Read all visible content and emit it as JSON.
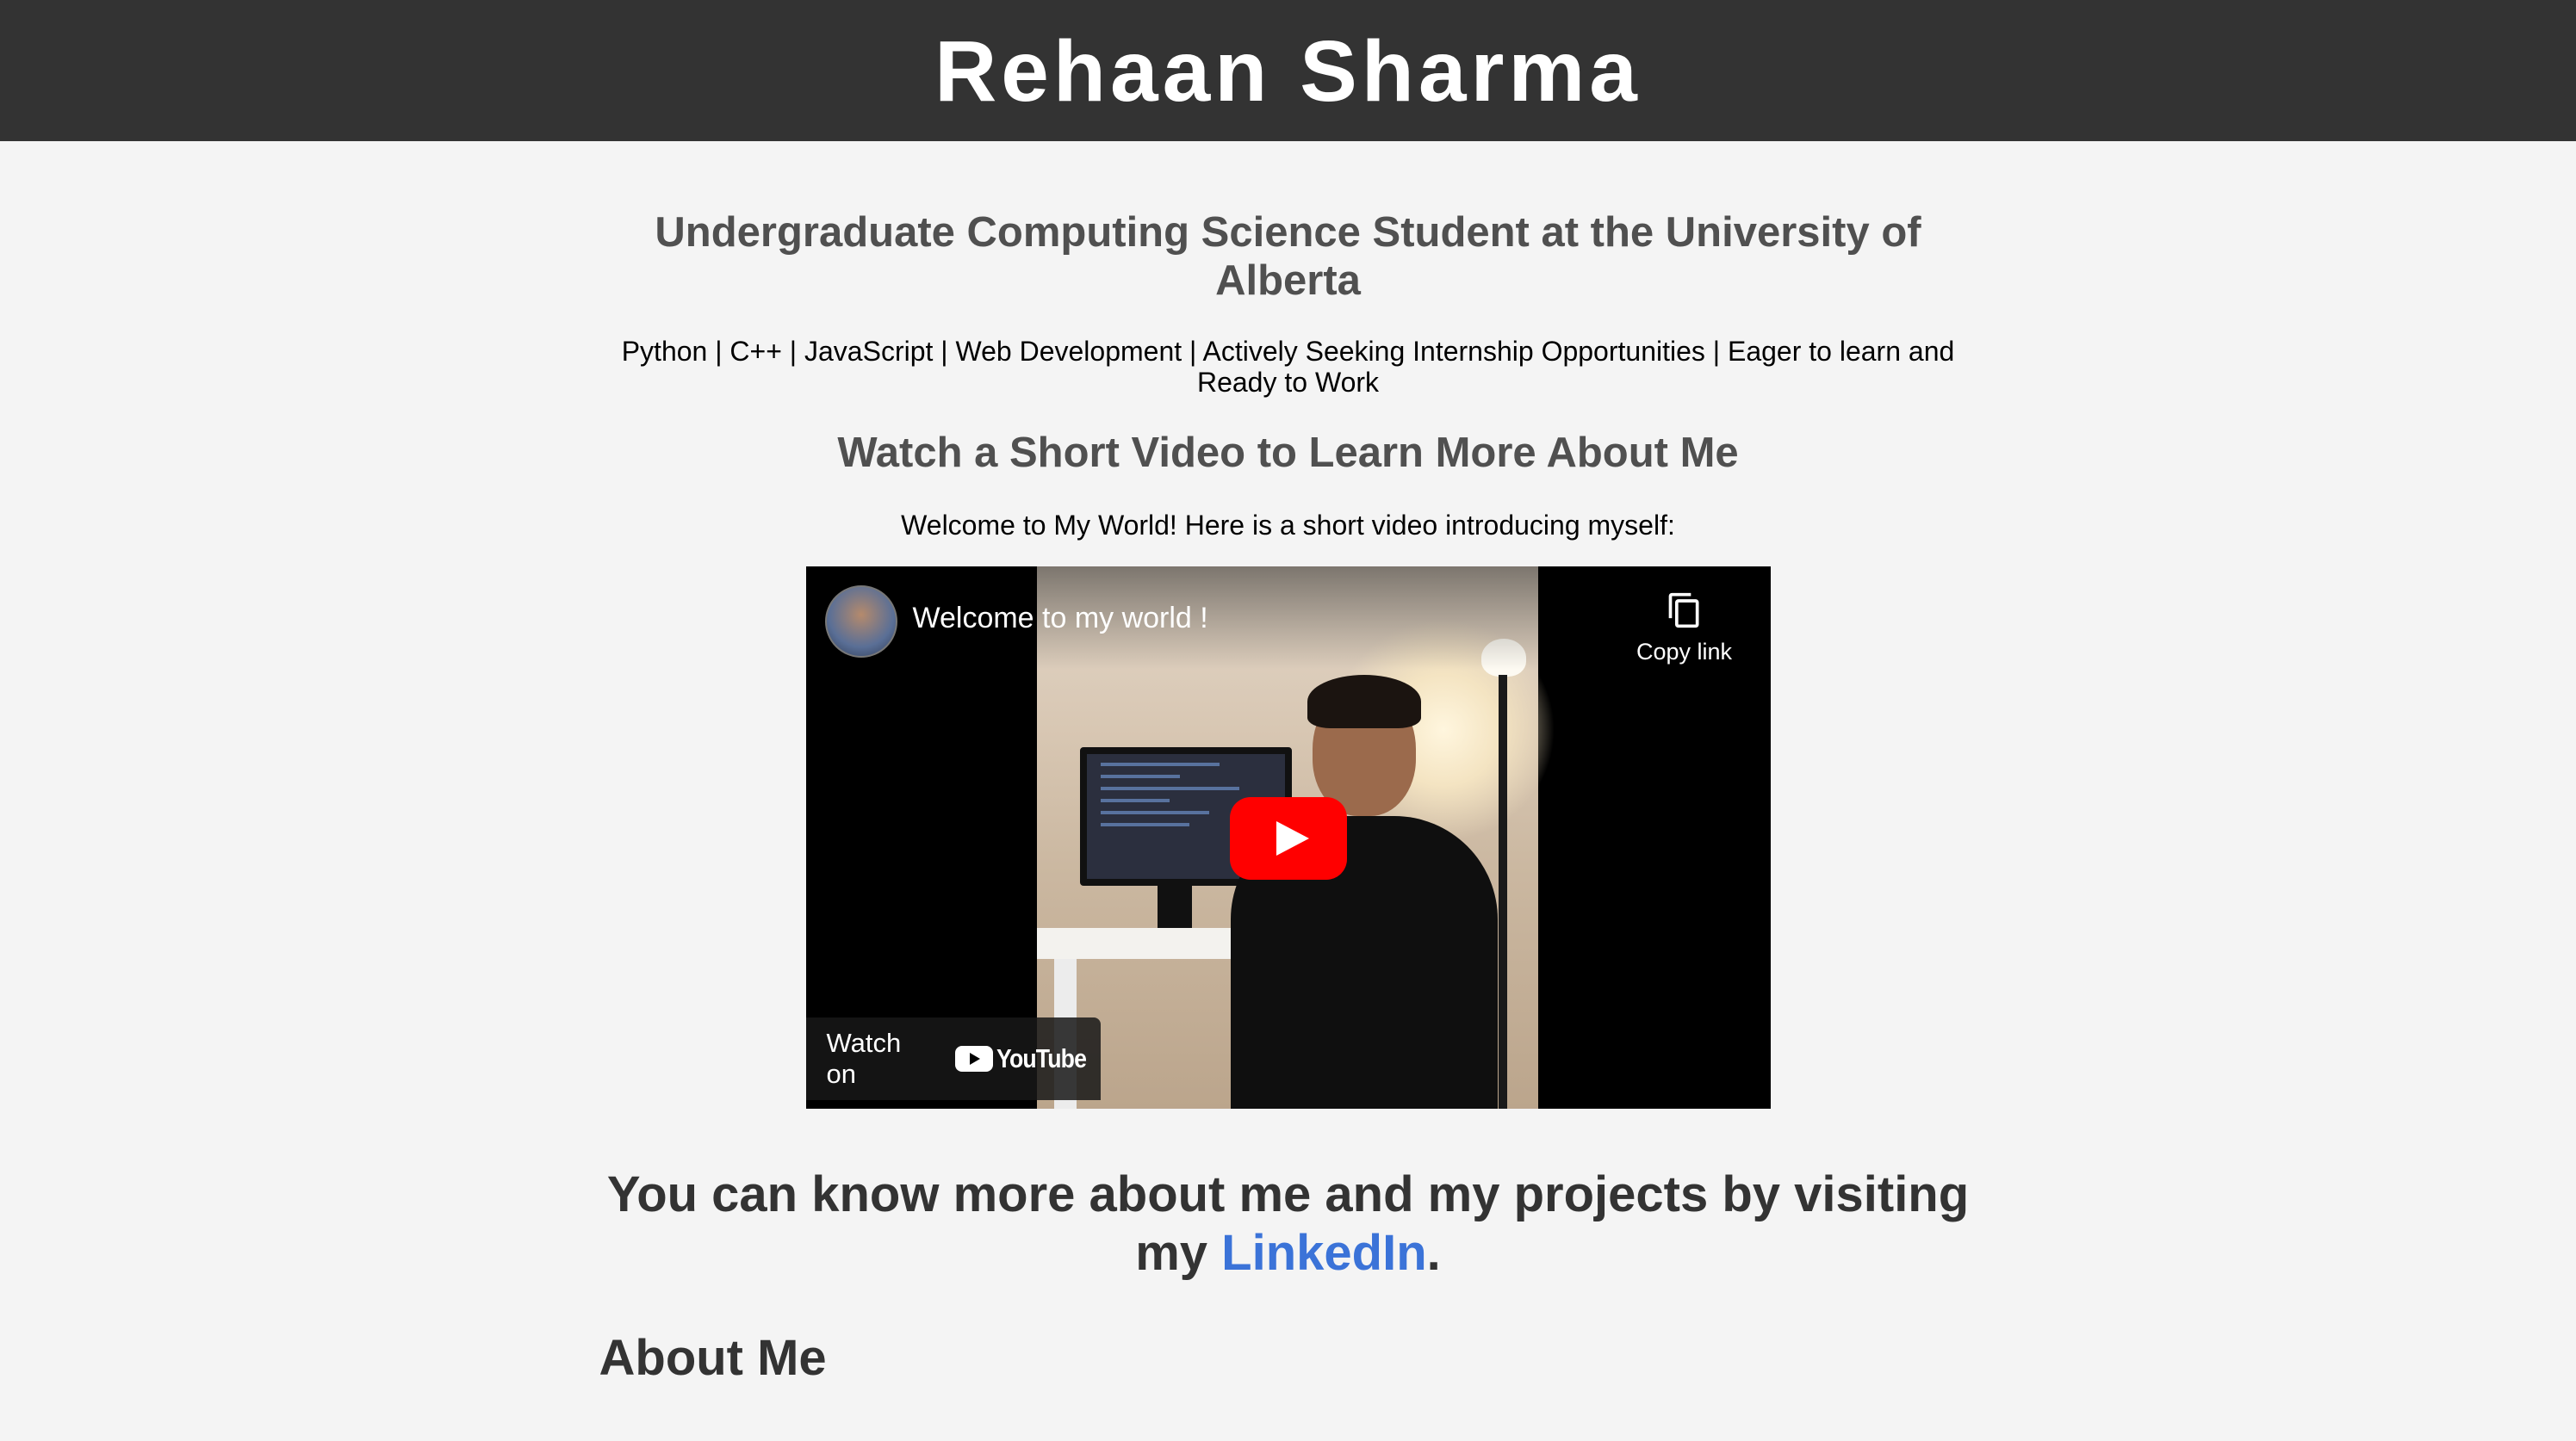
{
  "header": {
    "name": "Rehaan Sharma"
  },
  "intro": {
    "subtitle": "Undergraduate Computing Science Student at the University of Alberta",
    "skills": "Python | C++ | JavaScript | Web Development | Actively Seeking Internship Opportunities | Eager to learn and Ready to Work"
  },
  "video_section": {
    "heading": "Watch a Short Video to Learn More About Me",
    "intro": "Welcome to My World! Here is a short video introducing myself:",
    "player": {
      "title": "Welcome to my world !",
      "copy_link_label": "Copy link",
      "watch_on_label": "Watch on",
      "youtube_label": "YouTube",
      "play_color": "#ff0000"
    }
  },
  "linkedin": {
    "prefix": "You can know more about me and my projects by visiting my ",
    "link_text": "LinkedIn",
    "suffix": ".",
    "link_color": "#3b73d8"
  },
  "about": {
    "heading": "About Me"
  }
}
